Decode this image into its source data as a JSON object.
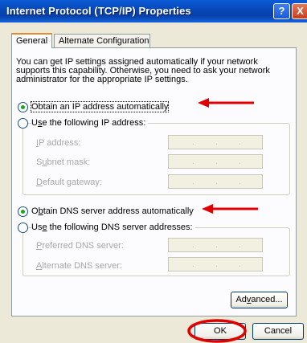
{
  "window": {
    "title": "Internet Protocol (TCP/IP) Properties",
    "help_glyph": "?",
    "close_glyph": "X"
  },
  "tabs": [
    {
      "label": "General",
      "active": true
    },
    {
      "label": "Alternate Configuration",
      "active": false
    }
  ],
  "description": "You can get IP settings assigned automatically if your network supports this capability. Otherwise, you need to ask your network administrator for the appropriate IP settings.",
  "ip": {
    "auto_label": "Obtain an IP address automatically",
    "auto_checked": true,
    "manual_label_pre": "U",
    "manual_label_key": "s",
    "manual_label_post": "e the following IP address:",
    "fields": [
      {
        "pre": "",
        "key": "I",
        "post": "P address:"
      },
      {
        "pre": "S",
        "key": "u",
        "post": "bnet mask:"
      },
      {
        "pre": "",
        "key": "D",
        "post": "efault gateway:"
      }
    ]
  },
  "dns": {
    "auto_label_pre": "O",
    "auto_label_key": "b",
    "auto_label_post": "tain DNS server address automatically",
    "auto_checked": true,
    "manual_label_pre": "Us",
    "manual_label_key": "e",
    "manual_label_post": " the following DNS server addresses:",
    "fields": [
      {
        "pre": "",
        "key": "P",
        "post": "referred DNS server:"
      },
      {
        "pre": "",
        "key": "A",
        "post": "lternate DNS server:"
      }
    ]
  },
  "buttons": {
    "advanced_pre": "Ad",
    "advanced_key": "v",
    "advanced_post": "anced...",
    "ok": "OK",
    "cancel": "Cancel"
  },
  "ip_dots": [
    ".",
    ".",
    "."
  ],
  "annotation_color": "#e00000",
  "accent_color": "#0a5bd6"
}
